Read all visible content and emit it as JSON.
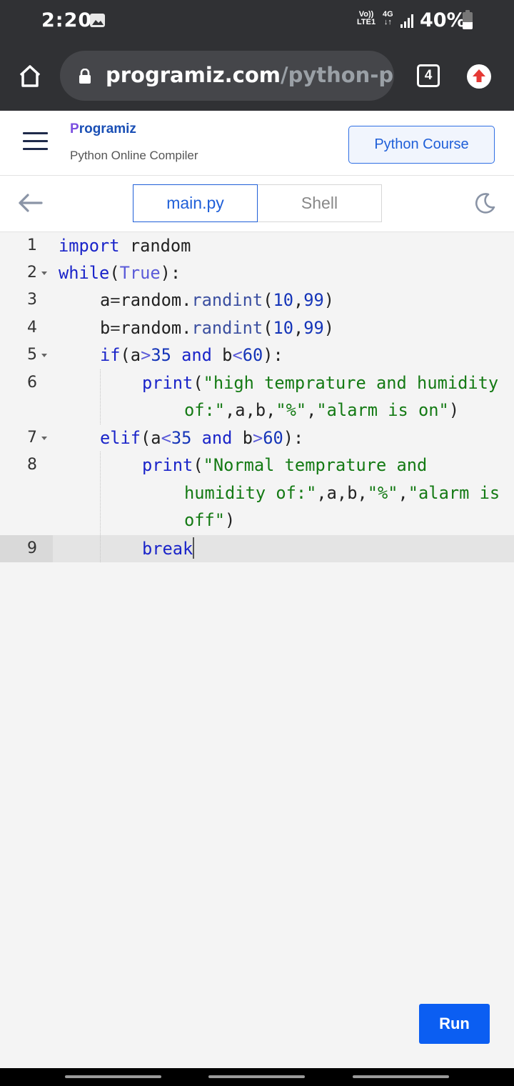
{
  "status_bar": {
    "time": "2:20",
    "volte_label": "Vo))",
    "lte_label": "LTE1",
    "network_type": "4G",
    "data_arrows": "↓↑",
    "battery_percent_text": "40%",
    "battery_level": 0.4,
    "icons": [
      "gallery-icon",
      "signal-icon",
      "battery-icon"
    ]
  },
  "browser": {
    "url_domain": "programiz.com",
    "url_path": "/python-pro",
    "tab_count": "4",
    "icons": [
      "home-icon",
      "lock-icon",
      "update-icon"
    ],
    "update_color": "#e53935"
  },
  "site": {
    "logo_first": "P",
    "logo_rest": "rogramiz",
    "subtitle": "Python Online Compiler",
    "course_button": "Python Course"
  },
  "editor_tabs": {
    "main": "main.py",
    "shell": "Shell",
    "icons": [
      "back-arrow-icon",
      "moon-icon"
    ]
  },
  "code": {
    "line_numbers": [
      "1",
      "2",
      "3",
      "4",
      "5",
      "6",
      "7",
      "8",
      "9"
    ],
    "lines": {
      "l1": {
        "kw": "import",
        "rest": " random"
      },
      "l2": {
        "kw": "while",
        "p1": "(",
        "builtin": "True",
        "p2": "):"
      },
      "l3": {
        "a": "a",
        "eq": "=",
        "mod": "random.",
        "fn": "randint",
        "open": "(",
        "n1": "10",
        "comma": ",",
        "n2": "99",
        "close": ")"
      },
      "l4": {
        "a": "b",
        "eq": "=",
        "mod": "random.",
        "fn": "randint",
        "open": "(",
        "n1": "10",
        "comma": ",",
        "n2": "99",
        "close": ")"
      },
      "l5": {
        "kw": "if",
        "p1": "(a",
        "op1": ">",
        "n1": "35",
        "and": " and ",
        "b": "b",
        "op2": "<",
        "n2": "60",
        "p2": "):"
      },
      "l6a": {
        "fn": "print",
        "p1": "(",
        "str": "\"high temprature and humidity"
      },
      "l6b": {
        "str1": "of:\"",
        "mid": ",a,b,",
        "str2": "\"%\"",
        "comma": ",",
        "str3": "\"alarm is on\"",
        "close": ")"
      },
      "l7": {
        "kw": "elif",
        "p1": "(a",
        "op1": "<",
        "n1": "35",
        "and": " and ",
        "b": "b",
        "op2": ">",
        "n2": "60",
        "p2": "):"
      },
      "l8a": {
        "fn": "print",
        "p1": "(",
        "str": "\"Normal temprature and"
      },
      "l8b": {
        "str1": "humidity of:\"",
        "mid": ",a,b,",
        "str2": "\"%\"",
        "comma": ",",
        "str3": "\"alarm is"
      },
      "l8c": {
        "str": "off\"",
        "close": ")"
      },
      "l9": {
        "kw": "break"
      }
    }
  },
  "run_button": "Run"
}
